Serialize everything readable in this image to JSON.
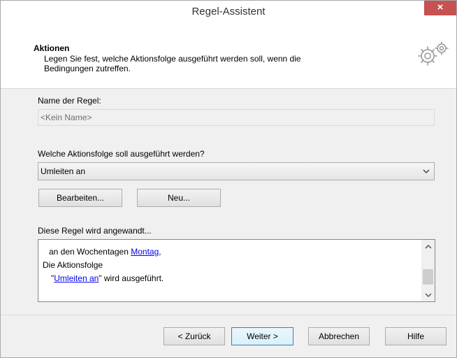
{
  "window": {
    "title": "Regel-Assistent",
    "close_label": "×"
  },
  "header": {
    "title": "Aktionen",
    "description": "Legen Sie fest, welche Aktionsfolge ausgeführt werden soll, wenn die Bedingungen zutreffen."
  },
  "rule_name": {
    "label": "Name der Regel:",
    "value": "<Kein Name>"
  },
  "action_sequence": {
    "label": "Welche Aktionsfolge soll ausgeführt werden?",
    "selected": "Umleiten an",
    "edit_button": "Bearbeiten...",
    "new_button": "Neu..."
  },
  "applies": {
    "label": "Diese Regel wird angewandt...",
    "line1_prefix": "an den Wochentagen ",
    "line1_link": "Montag",
    "line1_suffix": ",",
    "line2": "Die Aktionsfolge",
    "line3_open_quote": "\"",
    "line3_link": "Umleiten an",
    "line3_suffix": "\" wird ausgeführt."
  },
  "footer": {
    "back": "< Zurück",
    "next": "Weiter >",
    "cancel": "Abbrechen",
    "help": "Hilfe"
  },
  "icons": {
    "header": "gears-icon",
    "dropdown": "chevron-down-icon"
  }
}
